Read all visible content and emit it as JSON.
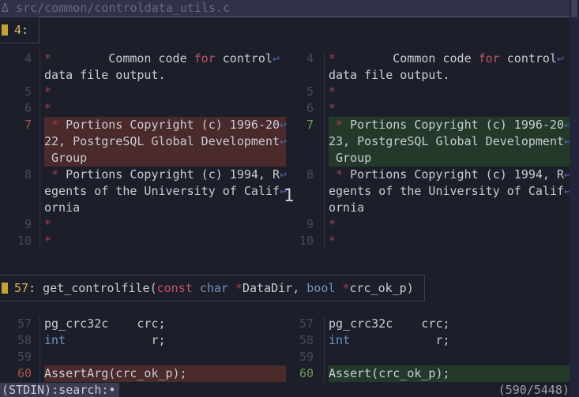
{
  "file_header": {
    "path": "src/common/controldata_utils.c",
    "leading_glyph": "Δ"
  },
  "hunks": [
    {
      "line": "4",
      "suffix": ":",
      "text": ""
    },
    {
      "line": "57",
      "suffix": ":",
      "text": "get_controlfile(const char *DataDir, bool *crc_ok_p)"
    }
  ],
  "diff_block_1": {
    "left_numbers": [
      "4",
      "",
      "5",
      "6",
      "7",
      "",
      "",
      "8",
      "",
      "",
      "9",
      "10"
    ],
    "right_numbers": [
      "4",
      "",
      "5",
      "6",
      "7",
      "",
      "",
      "8",
      "",
      "",
      "9",
      "10"
    ],
    "left_lines": [
      "*        Common code for control",
      "data file output.",
      "*",
      "*",
      " * Portions Copyright (c) 1996-20",
      "22, PostgreSQL Global Development",
      " Group",
      " * Portions Copyright (c) 1994, R",
      "egents of the University of Calif",
      "ornia",
      "*",
      "*"
    ],
    "right_lines": [
      "*        Common code for control",
      "data file output.",
      "*",
      "*",
      " * Portions Copyright (c) 1996-20",
      "23, PostgreSQL Global Development",
      " Group",
      " * Portions Copyright (c) 1994, R",
      "egents of the University of Calif",
      "ornia",
      "*",
      "*"
    ]
  },
  "diff_block_2": {
    "left_numbers": [
      "57",
      "58",
      "59",
      "60"
    ],
    "right_numbers": [
      "57",
      "58",
      "59",
      "60"
    ],
    "left_lines": [
      "pg_crc32c    crc;",
      "int            r;",
      "",
      "AssertArg(crc_ok_p);"
    ],
    "right_lines": [
      "pg_crc32c    crc;",
      "int            r;",
      "",
      "Assert(crc_ok_p);"
    ]
  },
  "overlay_number": "1",
  "status": {
    "left": "(STDIN):search:",
    "cursor": "•",
    "right": "(590/5448)"
  }
}
